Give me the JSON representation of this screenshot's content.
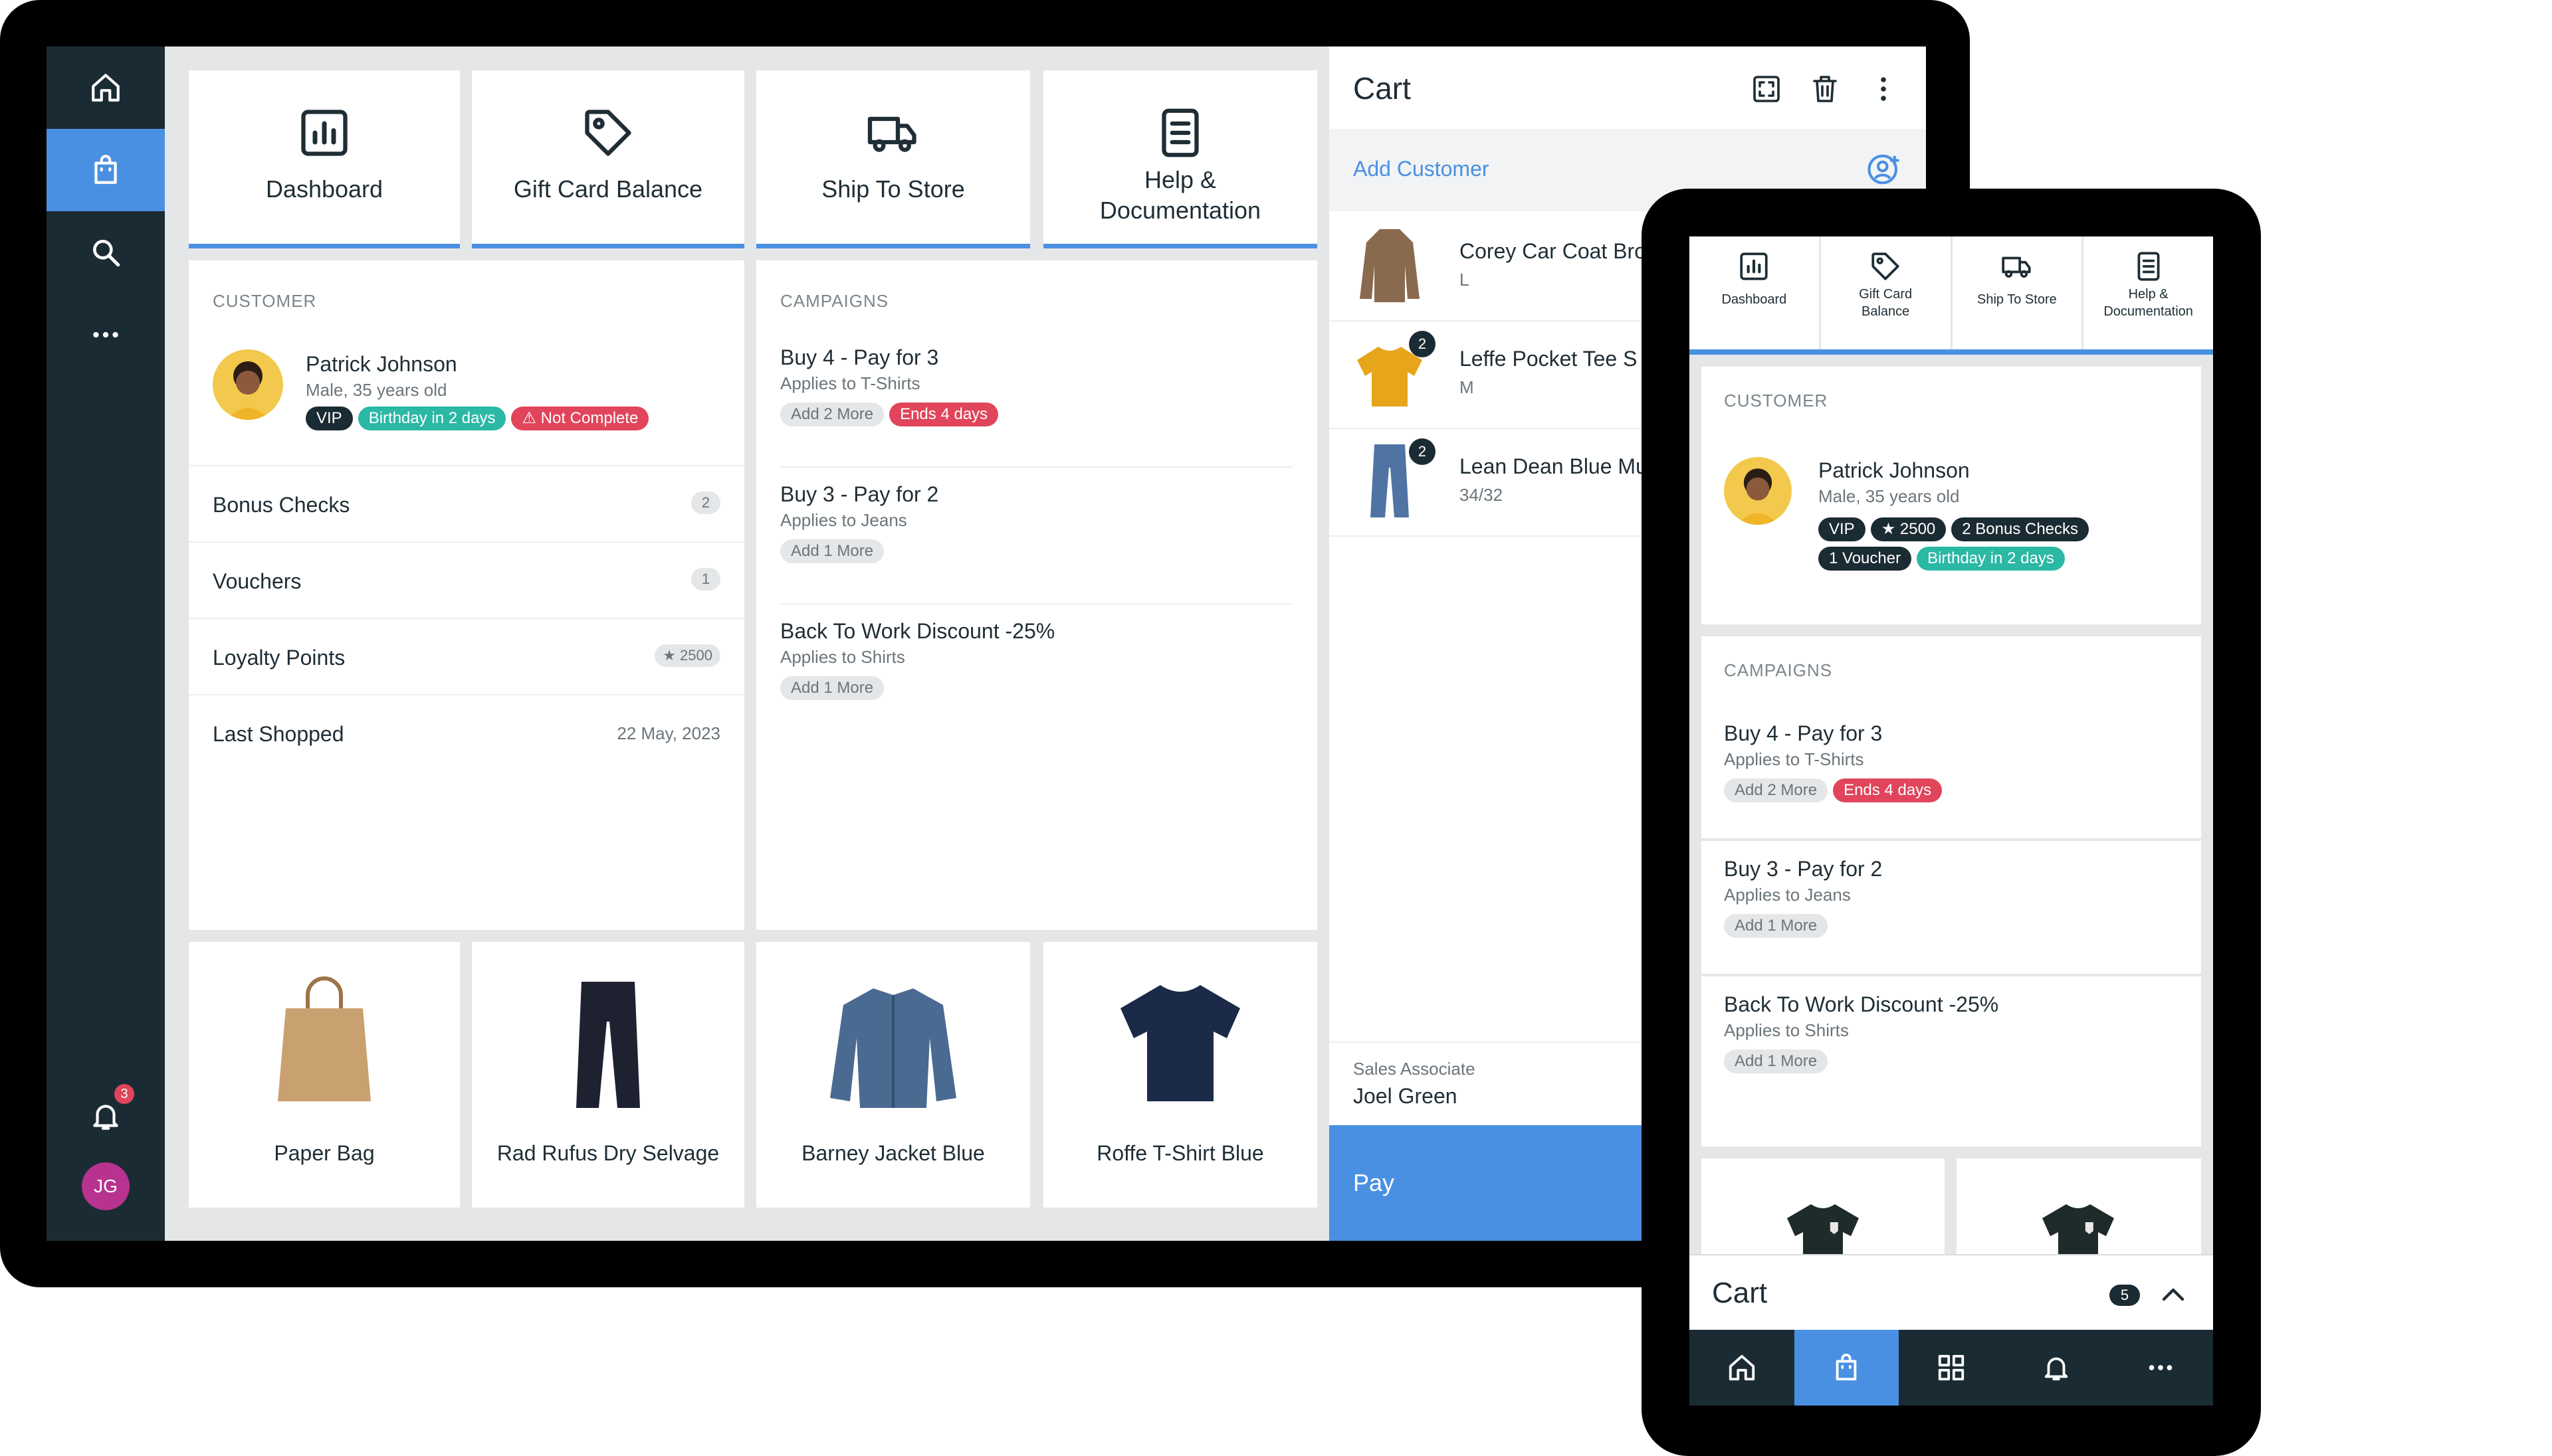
{
  "tablet": {
    "rail": {
      "notifications_count": "3",
      "user_initials": "JG"
    },
    "tiles": [
      {
        "label": "Dashboard"
      },
      {
        "label": "Gift Card Balance"
      },
      {
        "label": "Ship To Store"
      },
      {
        "label": "Help &",
        "label2": "Documentation"
      }
    ],
    "customer": {
      "section_title": "CUSTOMER",
      "name": "Patrick Johnson",
      "details": "Male, 35 years old",
      "badges": [
        "VIP",
        "Birthday in 2 days",
        "Not Complete"
      ],
      "rows": [
        {
          "label": "Bonus Checks",
          "value": "2"
        },
        {
          "label": "Vouchers",
          "value": "1"
        },
        {
          "label": "Loyalty Points",
          "value": "2500"
        },
        {
          "label": "Last Shopped",
          "value": "22 May, 2023"
        }
      ]
    },
    "campaigns": {
      "section_title": "CAMPAIGNS",
      "items": [
        {
          "title": "Buy 4 - Pay for 3",
          "subtitle": "Applies to T-Shirts",
          "add": "Add 2 More",
          "ends": "Ends 4 days"
        },
        {
          "title": "Buy 3 - Pay for 2",
          "subtitle": "Applies to Jeans",
          "add": "Add 1 More"
        },
        {
          "title": "Back To Work Discount -25%",
          "subtitle": "Applies to Shirts",
          "add": "Add 1 More"
        }
      ]
    },
    "products": [
      {
        "label": "Paper Bag"
      },
      {
        "label": "Rad Rufus Dry Selvage"
      },
      {
        "label": "Barney Jacket Blue"
      },
      {
        "label": "Roffe T-Shirt Blue"
      }
    ],
    "cart": {
      "title": "Cart",
      "add_customer": "Add Customer",
      "items": [
        {
          "name": "Corey Car Coat Bro",
          "variant": "L"
        },
        {
          "name": "Leffe Pocket Tee S",
          "variant": "M",
          "qty": "2"
        },
        {
          "name": "Lean Dean Blue Mu",
          "variant": "34/32",
          "qty": "2"
        }
      ],
      "sales_associate_label": "Sales Associate",
      "sales_associate_name": "Joel Green",
      "pay_label": "Pay"
    }
  },
  "phone": {
    "tiles": [
      {
        "label": "Dashboard"
      },
      {
        "label": "Gift Card",
        "label2": "Balance"
      },
      {
        "label": "Ship To Store"
      },
      {
        "label": "Help &",
        "label2": "Documentation"
      }
    ],
    "customer": {
      "section_title": "CUSTOMER",
      "name": "Patrick Johnson",
      "details": "Male, 35 years old",
      "badges": [
        "VIP",
        "2500",
        "2 Bonus Checks",
        "1 Voucher",
        "Birthday in 2 days"
      ]
    },
    "campaigns": {
      "section_title": "CAMPAIGNS",
      "items": [
        {
          "title": "Buy 4 - Pay for 3",
          "subtitle": "Applies to T-Shirts",
          "add": "Add 2 More",
          "ends": "Ends 4 days"
        },
        {
          "title": "Buy 3 - Pay for 2",
          "subtitle": "Applies to Jeans",
          "add": "Add 1 More"
        },
        {
          "title": "Back To Work Discount -25%",
          "subtitle": "Applies to Shirts",
          "add": "Add 1 More"
        }
      ]
    },
    "cart_bar": {
      "label": "Cart",
      "count": "5"
    }
  },
  "colors": {
    "accent": "#4a90e2",
    "rail": "#1b2b33",
    "teal_badge": "#2bb8a5",
    "red_badge": "#e0455b",
    "avatar": "#b7338f"
  }
}
